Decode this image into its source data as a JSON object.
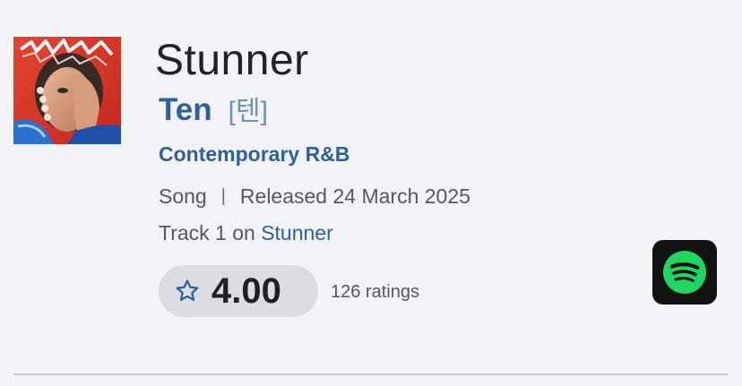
{
  "song": {
    "title": "Stunner",
    "artist": "Ten",
    "artist_native": "[텐]",
    "genre": "Contemporary R&B",
    "type": "Song",
    "separator": "|",
    "released": "Released 24 March 2025",
    "track_prefix": "Track 1 on ",
    "album": "Stunner"
  },
  "rating": {
    "value": "4.00",
    "count_text": "126 ratings"
  },
  "colors": {
    "link": "#2f5f9e",
    "spotify_green": "#1ed760"
  },
  "icons": {
    "rating": "star-outline-icon",
    "streaming": "spotify-icon"
  }
}
